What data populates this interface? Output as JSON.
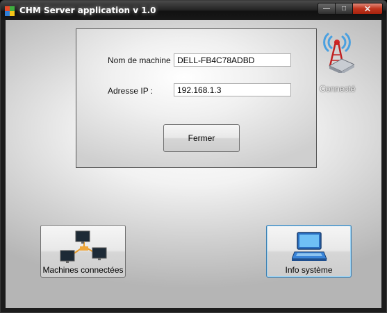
{
  "window": {
    "title": "CHM Server application v 1.0",
    "controls": {
      "minimize": "—",
      "maximize": "□",
      "close": "✕"
    }
  },
  "info": {
    "machine_label": "Nom de machine :",
    "machine_value": "DELL-FB4C78ADBD",
    "ip_label": "Adresse IP :",
    "ip_value": "192.168.1.3",
    "close_button": "Fermer"
  },
  "status": {
    "label": "Connecté",
    "icon": "wireless-router-icon"
  },
  "buttons": {
    "machines": {
      "label": "Machines connectées",
      "icon": "networked-computers-icon"
    },
    "sysinfo": {
      "label": "Info système",
      "icon": "laptop-icon"
    }
  },
  "colors": {
    "accent": "#3c7fb1",
    "antenna": "#d22626",
    "wave": "#4aa0e0",
    "panel_border": "#555555"
  }
}
